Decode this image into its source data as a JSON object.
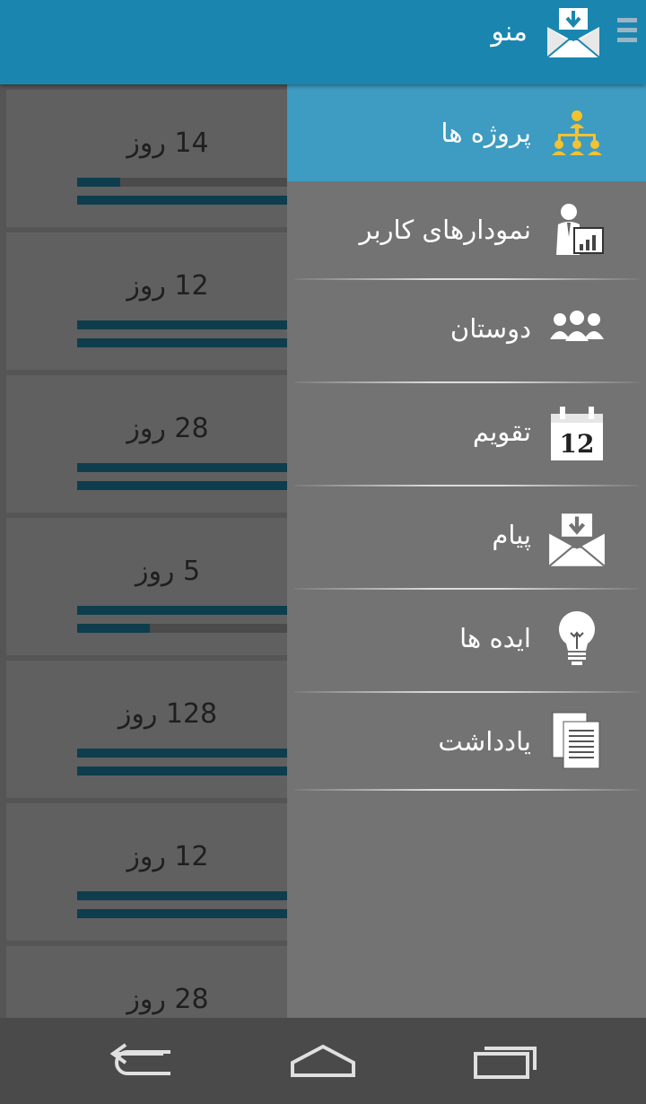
{
  "header": {
    "title": "منو",
    "app_icon": "mail-download-icon",
    "drawer_toggle_icon": "overflow-lines-icon",
    "bar_color": "#1a86b0"
  },
  "projects": [
    {
      "days": "14 روز",
      "progress_top": 0.16,
      "progress_bottom": 0.9
    },
    {
      "days": "12 روز",
      "progress_top": 1.0,
      "progress_bottom": 1.0
    },
    {
      "days": "28 روز",
      "progress_top": 1.0,
      "progress_bottom": 1.0
    },
    {
      "days": "5 روز",
      "progress_top": 1.0,
      "progress_bottom": 0.27
    },
    {
      "days": "128 روز",
      "progress_top": 1.0,
      "progress_bottom": 1.0
    },
    {
      "days": "12 روز",
      "progress_top": 1.0,
      "progress_bottom": 1.0
    },
    {
      "days": "28 روز",
      "progress_top": 1.0,
      "progress_bottom": 1.0
    }
  ],
  "drawer": {
    "active_color": "#3e9bc1",
    "items": [
      {
        "label": "پروژه ها",
        "icon": "org-chart-icon",
        "active": true
      },
      {
        "label": "نمودارهای کاربر",
        "icon": "user-chart-icon",
        "active": false
      },
      {
        "label": "دوستان",
        "icon": "group-icon",
        "active": false
      },
      {
        "label": "تقویم",
        "icon": "calendar-icon",
        "active": false,
        "icon_text": "12"
      },
      {
        "label": "پیام",
        "icon": "mail-download-icon",
        "active": false
      },
      {
        "label": "ایده ها",
        "icon": "lightbulb-icon",
        "active": false
      },
      {
        "label": "یادداشت",
        "icon": "notes-icon",
        "active": false
      }
    ]
  },
  "system_nav": {
    "back": "back-icon",
    "home": "home-icon",
    "recents": "recents-icon"
  }
}
